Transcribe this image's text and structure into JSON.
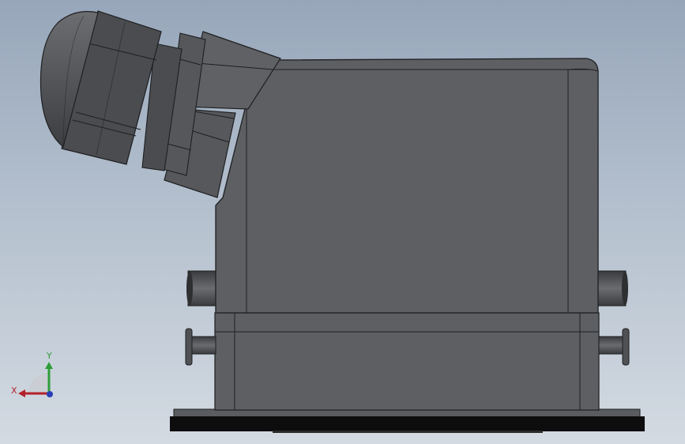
{
  "viewport": {
    "background_top": "#97a6ba",
    "background_bottom": "#d3dae2"
  },
  "model": {
    "body_color": "#5d5f62",
    "edge_color": "#1e1f21",
    "gland_color": "#4b4c4f",
    "base_plate_color": "#0d0d0e"
  },
  "triad": {
    "x_label": "X",
    "y_label": "Y",
    "x_color": "#b3202a",
    "y_color": "#2f9c3a",
    "z_color": "#2a3fb5"
  }
}
